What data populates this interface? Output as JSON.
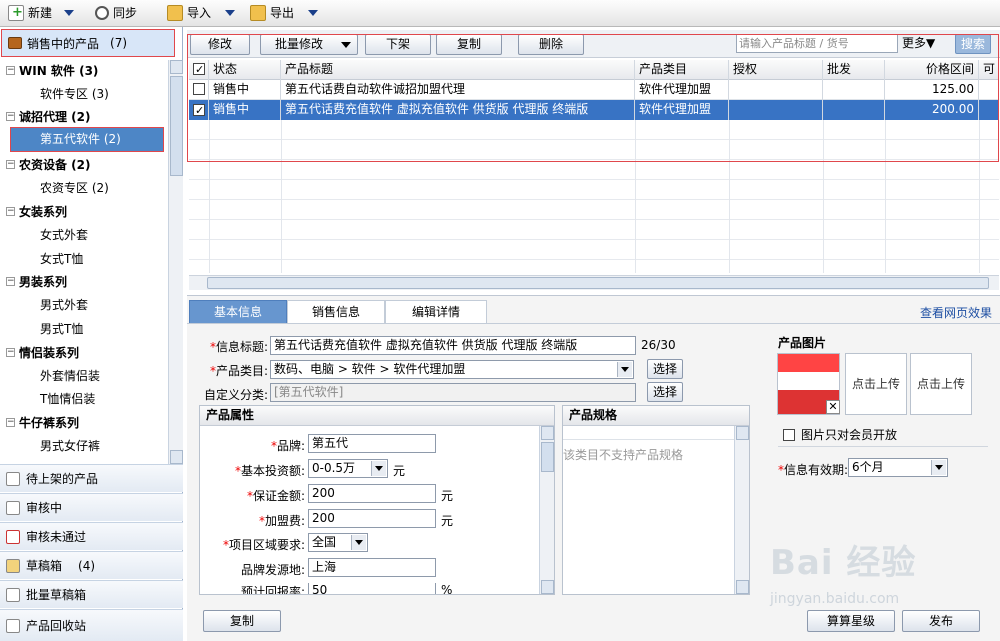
{
  "toolbar": {
    "new_label": "新建",
    "sync_label": "同步",
    "import_label": "导入",
    "export_label": "导出"
  },
  "sidebar": {
    "header_label": "销售中的产品",
    "header_count": "(7)",
    "tree": [
      {
        "cat": "WIN 软件 (3)",
        "items": [
          "软件专区 (3)"
        ]
      },
      {
        "cat": "诚招代理 (2)",
        "items": [
          "第五代软件 (2)"
        ]
      },
      {
        "cat": "农资设备 (2)",
        "items": [
          "农资专区 (2)"
        ]
      },
      {
        "cat": "女装系列",
        "items": [
          "女式外套",
          "女式T恤"
        ]
      },
      {
        "cat": "男装系列",
        "items": [
          "男式外套",
          "男式T恤"
        ]
      },
      {
        "cat": "情侣装系列",
        "items": [
          "外套情侣装",
          "T恤情侣装"
        ]
      },
      {
        "cat": "牛仔裤系列",
        "items": [
          "男式女仔裤"
        ]
      }
    ],
    "bottom": [
      {
        "label": "待上架的产品",
        "count": ""
      },
      {
        "label": "审核中",
        "count": ""
      },
      {
        "label": "审核未通过",
        "count": ""
      },
      {
        "label": "草稿箱",
        "count": "(4)"
      },
      {
        "label": "批量草稿箱",
        "count": ""
      },
      {
        "label": "产品回收站",
        "count": ""
      }
    ]
  },
  "actions": {
    "edit": "修改",
    "batch_edit": "批量修改",
    "unlist": "下架",
    "copy": "复制",
    "delete": "删除",
    "search_placeholder": "请输入产品标题 / 货号",
    "more": "更多▼",
    "search": "搜索"
  },
  "table": {
    "headers": [
      "状态",
      "产品标题",
      "产品类目",
      "授权",
      "批发",
      "价格区间",
      "可"
    ],
    "rows": [
      {
        "checked": false,
        "status": "销售中",
        "title": "第五代话费自动软件诚招加盟代理",
        "category": "软件代理加盟",
        "auth": "",
        "wholesale": "",
        "price": "125.00"
      },
      {
        "checked": true,
        "status": "销售中",
        "title": "第五代话费充值软件 虚拟充值软件 供货版 代理版 终端版",
        "category": "软件代理加盟",
        "auth": "",
        "wholesale": "",
        "price": "200.00"
      }
    ]
  },
  "detail": {
    "tabs": [
      "基本信息",
      "销售信息",
      "编辑详情"
    ],
    "view_web": "查看网页效果",
    "info_title_label": "信息标题:",
    "info_title_value": "第五代话费充值软件 虚拟充值软件 供货版 代理版 终端版",
    "info_title_count": "26/30",
    "category_label": "产品类目:",
    "category_value": "数码、电脑 > 软件 > 软件代理加盟",
    "custom_cat_label": "自定义分类:",
    "custom_cat_value": "[第五代软件]",
    "choose": "选择",
    "attr_panel_title": "产品属性",
    "spec_panel_title": "产品规格",
    "spec_empty": "该类目不支持产品规格",
    "attrs": [
      {
        "label": "品牌:",
        "value": "第五代",
        "unit": ""
      },
      {
        "label": "基本投资额:",
        "value": "0-0.5万",
        "unit": "元"
      },
      {
        "label": "保证金额:",
        "value": "200",
        "unit": "元"
      },
      {
        "label": "加盟费:",
        "value": "200",
        "unit": "元"
      },
      {
        "label": "项目区域要求:",
        "value": "全国",
        "unit": ""
      },
      {
        "label": "品牌发源地:",
        "value": "上海",
        "unit": ""
      },
      {
        "label": "预计回报率:",
        "value": "50",
        "unit": "%"
      }
    ],
    "image_title": "产品图片",
    "upload": "点击上传",
    "members_only": "图片只对会员开放",
    "validity_label": "信息有效期:",
    "validity_value": "6个月"
  },
  "bottom_buttons": {
    "copy": "复制",
    "calc": "算算星级",
    "publish": "发布"
  },
  "watermark": {
    "logo": "Bai 经验",
    "url": "jingyan.baidu.com"
  }
}
